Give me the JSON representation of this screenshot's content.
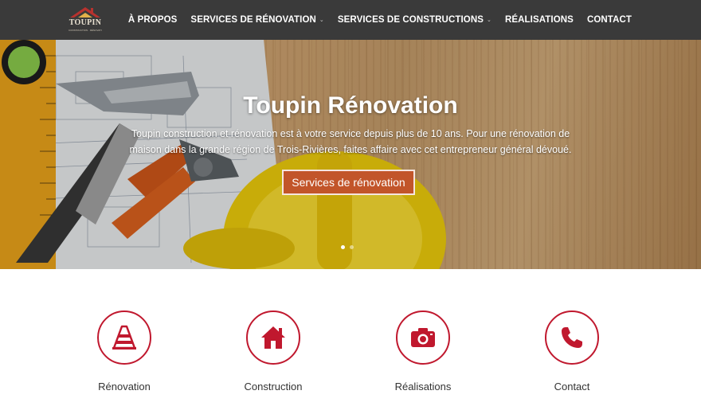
{
  "header": {
    "logo_text": "TOUPIN",
    "logo_subtext": "CONSTRUCTION · RÉNOVATION",
    "nav": [
      {
        "label": "À PROPOS",
        "has_dropdown": false
      },
      {
        "label": "SERVICES DE RÉNOVATION",
        "has_dropdown": true
      },
      {
        "label": "SERVICES DE CONSTRUCTIONS",
        "has_dropdown": true
      },
      {
        "label": "RÉALISATIONS",
        "has_dropdown": false
      },
      {
        "label": "CONTACT",
        "has_dropdown": false
      }
    ]
  },
  "hero": {
    "title": "Toupin Rénovation",
    "text": "Toupin construction et rénovation est à votre service depuis plus de 10 ans. Pour une rénovation de maison dans la grande région de Trois-Rivières, faites affaire avec cet entrepreneur général dévoué.",
    "button_label": "Services de rénovation",
    "slides_total": 2,
    "active_slide": 1
  },
  "services": [
    {
      "label": "Rénovation",
      "icon": "traffic-cone-icon"
    },
    {
      "label": "Construction",
      "icon": "house-icon"
    },
    {
      "label": "Réalisations",
      "icon": "camera-icon"
    },
    {
      "label": "Contact",
      "icon": "phone-icon"
    }
  ],
  "colors": {
    "header_bg": "#3a3a3a",
    "accent_red": "#c0182e",
    "button_orange": "#c2552a"
  }
}
